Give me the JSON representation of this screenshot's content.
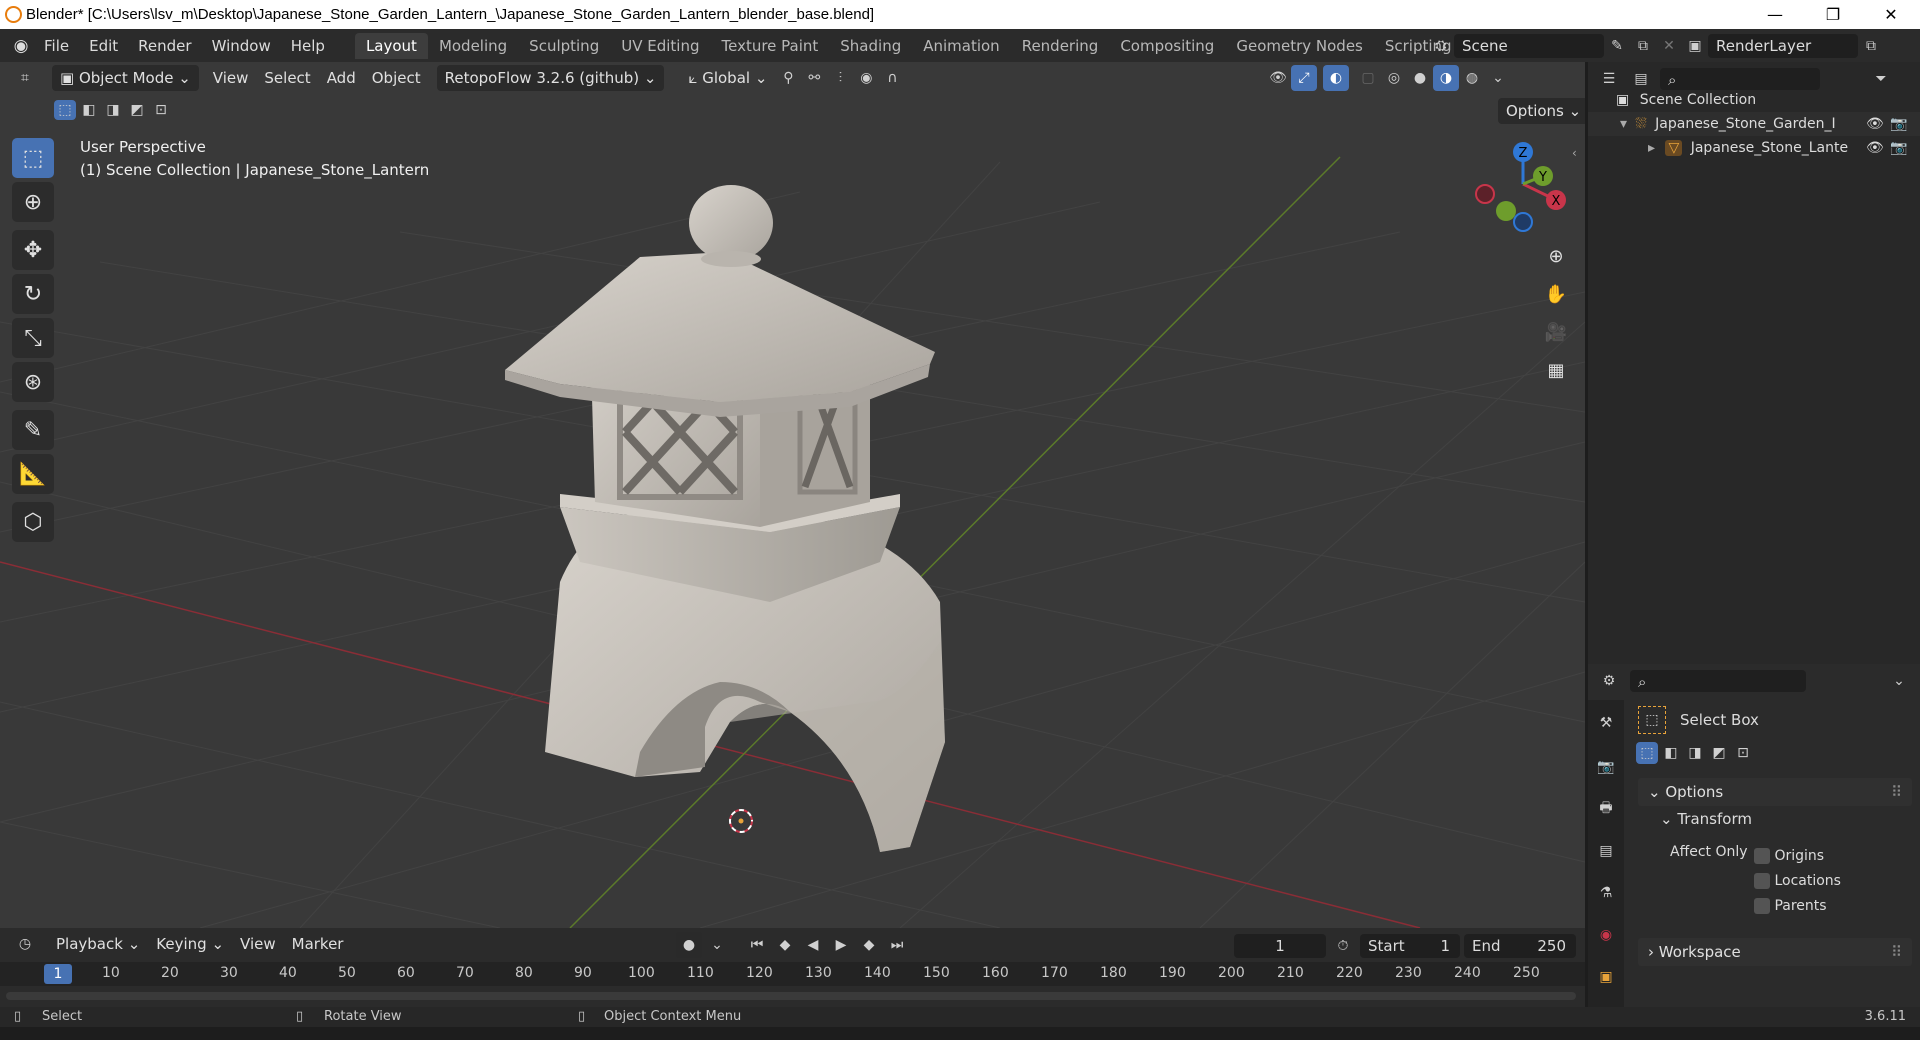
{
  "window": {
    "title": "Blender* [C:\\Users\\lsv_m\\Desktop\\Japanese_Stone_Garden_Lantern_\\Japanese_Stone_Garden_Lantern_blender_base.blend]",
    "minimize": "—",
    "restore": "❐",
    "close": "✕"
  },
  "menu": {
    "items": [
      "File",
      "Edit",
      "Render",
      "Window",
      "Help"
    ],
    "workspaces": [
      "Layout",
      "Modeling",
      "Sculpting",
      "UV Editing",
      "Texture Paint",
      "Shading",
      "Animation",
      "Rendering",
      "Compositing",
      "Geometry Nodes",
      "Scripting"
    ],
    "add_tab": "+",
    "scene": "Scene",
    "render_layer": "RenderLayer"
  },
  "viewport_header": {
    "mode": "Object Mode",
    "menus": [
      "View",
      "Select",
      "Add",
      "Object"
    ],
    "addon": "RetopoFlow 3.2.6 (github)",
    "orientation": "Global",
    "options": "Options"
  },
  "viewport": {
    "perspective": "User Perspective",
    "collection_info": "(1) Scene Collection | Japanese_Stone_Lantern"
  },
  "gizmo": {
    "z": "Z",
    "y": "Y",
    "x": "X"
  },
  "outliner": {
    "scene_collection": "Scene Collection",
    "items": [
      {
        "label": "Japanese_Stone_Garden_I"
      },
      {
        "label": "Japanese_Stone_Lante"
      }
    ]
  },
  "properties": {
    "tool_name": "Select Box",
    "options_label": "Options",
    "transform_label": "Transform",
    "affect_only": "Affect Only",
    "checks": [
      "Origins",
      "Locations",
      "Parents"
    ],
    "workspace_label": "Workspace"
  },
  "timeline": {
    "menus": [
      "Playback",
      "Keying",
      "View",
      "Marker"
    ],
    "current_frame": "1",
    "start_label": "Start",
    "start": "1",
    "end_label": "End",
    "end": "250",
    "ruler": [
      "1",
      "10",
      "20",
      "30",
      "40",
      "50",
      "60",
      "70",
      "80",
      "90",
      "100",
      "110",
      "120",
      "130",
      "140",
      "150",
      "160",
      "170",
      "180",
      "190",
      "200",
      "210",
      "220",
      "230",
      "240",
      "250"
    ]
  },
  "status": {
    "select": "Select",
    "rotate": "Rotate View",
    "context": "Object Context Menu",
    "version": "3.6.11"
  },
  "colors": {
    "accent": "#4772b3",
    "x_axis": "#c8354a",
    "y_axis": "#6e9d2c",
    "z_axis": "#2f78d6",
    "brand": "#e87d0d"
  }
}
